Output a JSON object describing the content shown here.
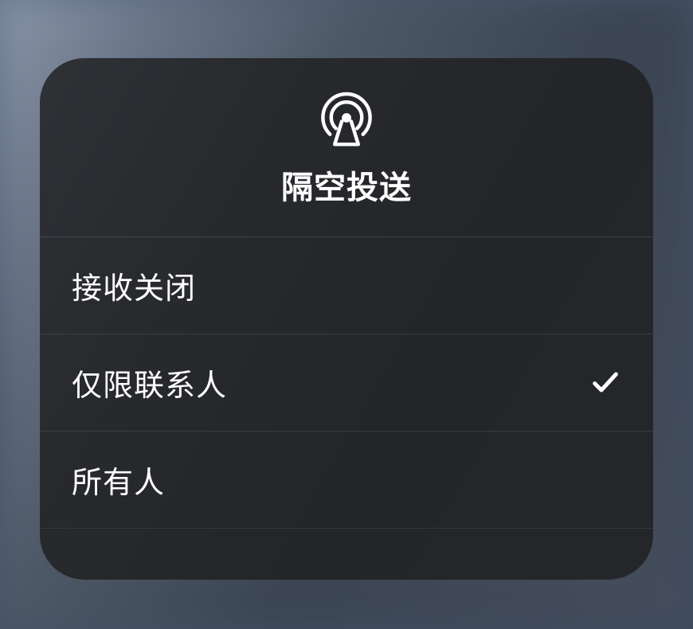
{
  "header": {
    "title": "隔空投送"
  },
  "options": [
    {
      "label": "接收关闭",
      "selected": false
    },
    {
      "label": "仅限联系人",
      "selected": true
    },
    {
      "label": "所有人",
      "selected": false
    }
  ]
}
